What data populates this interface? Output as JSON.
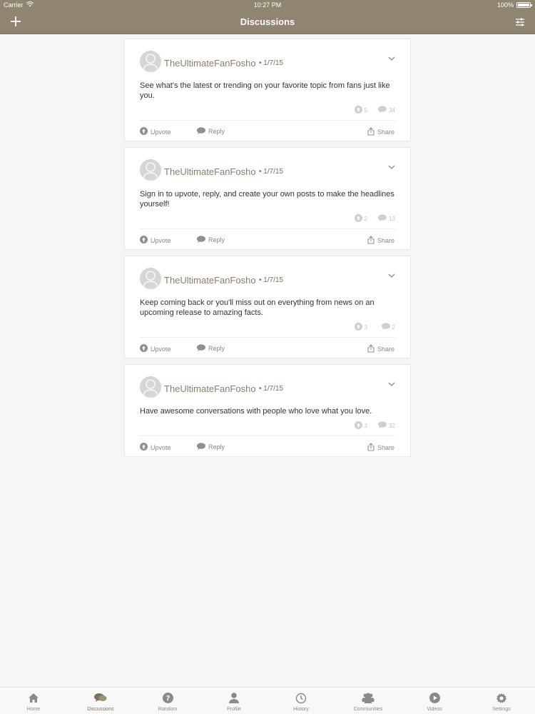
{
  "status_bar": {
    "carrier": "Carrier",
    "time": "10:27 PM",
    "battery": "100%",
    "battery_level": 1.0
  },
  "nav": {
    "title": "Discussions",
    "add_icon": "plus-icon",
    "filter_icon": "sliders-icon"
  },
  "posts": [
    {
      "username": "TheUltimateFanFosho",
      "date": "• 1/7/15",
      "text": "See what's the latest or trending on your favorite topic from fans just like you.",
      "upvotes": "5",
      "comments": "34",
      "upvote_label": "Upvote",
      "reply_label": "Reply",
      "share_label": "Share"
    },
    {
      "username": "TheUltimateFanFosho",
      "date": "• 1/7/15",
      "text": "Sign in to upvote, reply, and create your own posts to make the headlines yourself!",
      "upvotes": "2",
      "comments": "13",
      "upvote_label": "Upvote",
      "reply_label": "Reply",
      "share_label": "Share"
    },
    {
      "username": "TheUltimateFanFosho",
      "date": "• 1/7/15",
      "text": "Keep coming back or you'll miss out on everything from news on an upcoming release to amazing facts.",
      "upvotes": "3",
      "comments": "2",
      "upvote_label": "Upvote",
      "reply_label": "Reply",
      "share_label": "Share"
    },
    {
      "username": "TheUltimateFanFosho",
      "date": "• 1/7/15",
      "text": "Have awesome conversations with people who love what you love.",
      "upvotes": "3",
      "comments": "32",
      "upvote_label": "Upvote",
      "reply_label": "Reply",
      "share_label": "Share"
    }
  ],
  "tabs": [
    {
      "label": "Home",
      "icon": "home-icon",
      "active": false
    },
    {
      "label": "Discussions",
      "icon": "discussions-icon",
      "active": true
    },
    {
      "label": "Random",
      "icon": "random-icon",
      "active": false
    },
    {
      "label": "Profile",
      "icon": "profile-icon",
      "active": false
    },
    {
      "label": "History",
      "icon": "history-icon",
      "active": false
    },
    {
      "label": "Communities",
      "icon": "communities-icon",
      "active": false
    },
    {
      "label": "Videos",
      "icon": "videos-icon",
      "active": false
    },
    {
      "label": "Settings",
      "icon": "settings-icon",
      "active": false
    }
  ],
  "colors": {
    "header": "#8f8571",
    "accent": "#7d745f",
    "background": "#f6f6f7",
    "muted": "#c7c7c7"
  }
}
